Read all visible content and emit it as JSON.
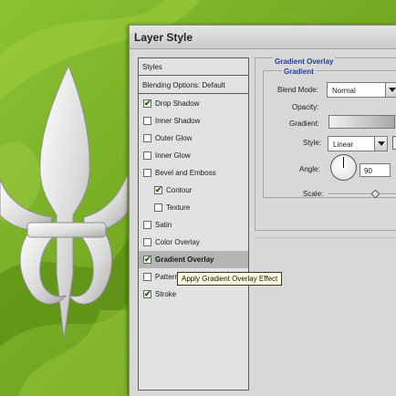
{
  "dialog": {
    "title": "Layer Style"
  },
  "style_list": {
    "header_styles": "Styles",
    "header_blending": "Blending Options: Default",
    "items": [
      {
        "label": "Drop Shadow",
        "checked": true,
        "indent": false,
        "selected": false
      },
      {
        "label": "Inner Shadow",
        "checked": false,
        "indent": false,
        "selected": false
      },
      {
        "label": "Outer Glow",
        "checked": false,
        "indent": false,
        "selected": false
      },
      {
        "label": "Inner Glow",
        "checked": false,
        "indent": false,
        "selected": false
      },
      {
        "label": "Bevel and Emboss",
        "checked": false,
        "indent": false,
        "selected": false
      },
      {
        "label": "Contour",
        "checked": true,
        "indent": true,
        "selected": false
      },
      {
        "label": "Texture",
        "checked": false,
        "indent": true,
        "selected": false
      },
      {
        "label": "Satin",
        "checked": false,
        "indent": false,
        "selected": false
      },
      {
        "label": "Color Overlay",
        "checked": false,
        "indent": false,
        "selected": false
      },
      {
        "label": "Gradient Overlay",
        "checked": true,
        "indent": false,
        "selected": true
      },
      {
        "label": "Pattern Overlay",
        "checked": false,
        "indent": false,
        "selected": false
      },
      {
        "label": "Stroke",
        "checked": true,
        "indent": false,
        "selected": false
      }
    ]
  },
  "tooltip": "Apply Gradient Overlay Effect",
  "settings": {
    "group_title": "Gradient Overlay",
    "subgroup_title": "Gradient",
    "blend_mode_label": "Blend Mode:",
    "blend_mode_value": "Normal",
    "opacity_label": "Opacity:",
    "gradient_label": "Gradient:",
    "style_label": "Style:",
    "style_value": "Linear",
    "angle_label": "Angle:",
    "angle_value": "90",
    "scale_label": "Scale:",
    "scale_fraction": 0.7
  },
  "colors": {
    "background_green": "#6fa41c",
    "group_title_blue": "#1f3f99",
    "check_green": "#1a5c00"
  }
}
